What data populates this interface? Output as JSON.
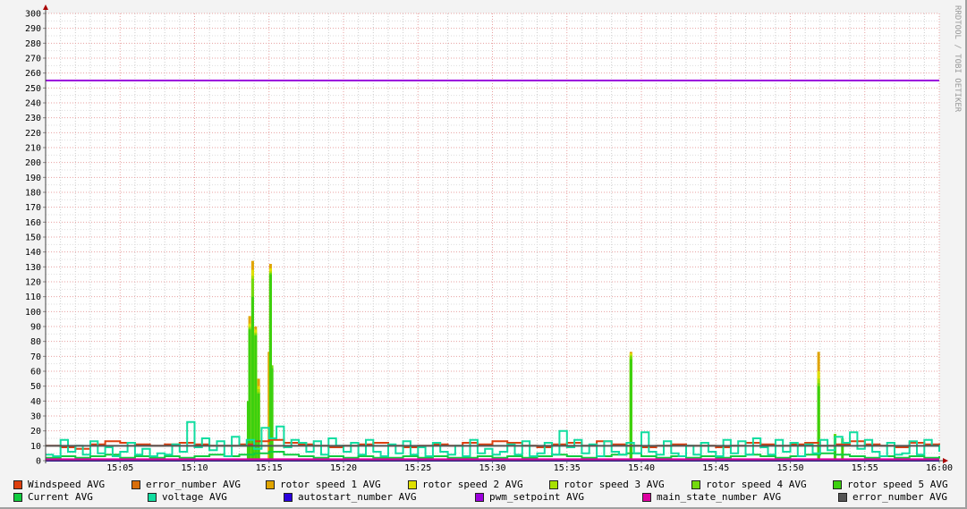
{
  "chart_data": {
    "type": "line",
    "title": "",
    "watermark": "RRDTOOL / TOBI OETIKER",
    "xlabel": "",
    "ylabel": "",
    "ylim": [
      0,
      300
    ],
    "xlim_minutes": [
      0,
      60
    ],
    "y_ticks": [
      "0",
      "10",
      "20",
      "30",
      "40",
      "50",
      "60",
      "70",
      "80",
      "90",
      "100",
      "110",
      "120",
      "130",
      "140",
      "150",
      "160",
      "170",
      "180",
      "190",
      "200",
      "210",
      "220",
      "230",
      "240",
      "250",
      "260",
      "270",
      "280",
      "290",
      "300"
    ],
    "x_ticks": [
      {
        "t": 5,
        "label": "15:05"
      },
      {
        "t": 10,
        "label": "15:10"
      },
      {
        "t": 15,
        "label": "15:15"
      },
      {
        "t": 20,
        "label": "15:20"
      },
      {
        "t": 25,
        "label": "15:25"
      },
      {
        "t": 30,
        "label": "15:30"
      },
      {
        "t": 35,
        "label": "15:35"
      },
      {
        "t": 40,
        "label": "15:40"
      },
      {
        "t": 45,
        "label": "15:45"
      },
      {
        "t": 50,
        "label": "15:50"
      },
      {
        "t": 55,
        "label": "15:55"
      },
      {
        "t": 60,
        "label": "16:00"
      }
    ],
    "series": [
      {
        "name": "Windspeed AVG",
        "color": "#dd3f0e",
        "kind": "line",
        "step": 1,
        "values": [
          10,
          9,
          8,
          11,
          13,
          12,
          11,
          10,
          11,
          12,
          11,
          10,
          10,
          11,
          13,
          14,
          12,
          11,
          10,
          9,
          10,
          11,
          12,
          10,
          9,
          10,
          11,
          10,
          12,
          11,
          13,
          12,
          10,
          9,
          11,
          12,
          10,
          13,
          11,
          10,
          9,
          10,
          11,
          10,
          10,
          9,
          10,
          12,
          11,
          10,
          11,
          12,
          10,
          11,
          13,
          11,
          10,
          9,
          12,
          11,
          10
        ]
      },
      {
        "name": "error_number AVG",
        "color": "#d96e0b",
        "kind": "const",
        "value": 0
      },
      {
        "name": "rotor speed 1 AVG",
        "color": "#e0a400",
        "kind": "spikes",
        "points": [
          [
            13.7,
            97
          ],
          [
            13.9,
            134
          ],
          [
            14.1,
            90
          ],
          [
            14.3,
            55
          ],
          [
            15.0,
            73
          ],
          [
            15.1,
            132
          ],
          [
            39.3,
            73
          ],
          [
            51.9,
            73
          ]
        ]
      },
      {
        "name": "rotor speed 2 AVG",
        "color": "#dfe000",
        "kind": "spikes",
        "points": [
          [
            13.7,
            92
          ],
          [
            13.9,
            128
          ],
          [
            14.1,
            88
          ],
          [
            14.3,
            50
          ],
          [
            15.1,
            129
          ],
          [
            39.3,
            72
          ],
          [
            51.9,
            60
          ]
        ]
      },
      {
        "name": "rotor speed 3 AVG",
        "color": "#a8e000",
        "kind": "spikes",
        "points": [
          [
            13.7,
            90
          ],
          [
            13.9,
            124
          ],
          [
            14.1,
            86
          ],
          [
            14.3,
            48
          ],
          [
            15.1,
            127
          ],
          [
            39.3,
            71
          ],
          [
            51.9,
            55
          ]
        ]
      },
      {
        "name": "rotor speed 4 AVG",
        "color": "#74d90e",
        "kind": "spikes",
        "points": [
          [
            13.7,
            89
          ],
          [
            13.9,
            122
          ],
          [
            14.1,
            85
          ],
          [
            14.3,
            46
          ],
          [
            15.1,
            126
          ],
          [
            15.2,
            64
          ],
          [
            39.3,
            70
          ],
          [
            51.9,
            52
          ],
          [
            53.0,
            18
          ]
        ]
      },
      {
        "name": "rotor speed 5 AVG",
        "color": "#3cd00e",
        "kind": "spikes",
        "points": [
          [
            13.6,
            40
          ],
          [
            13.7,
            88
          ],
          [
            13.9,
            110
          ],
          [
            14.1,
            84
          ],
          [
            14.3,
            45
          ],
          [
            15.1,
            125
          ],
          [
            15.2,
            62
          ],
          [
            39.3,
            68
          ],
          [
            51.9,
            50
          ],
          [
            53.0,
            17
          ],
          [
            53.5,
            15
          ]
        ]
      },
      {
        "name": "Current AVG",
        "color": "#11cc3f",
        "kind": "line",
        "step": 1,
        "values": [
          2,
          3,
          2,
          3,
          4,
          2,
          3,
          2,
          3,
          2,
          3,
          4,
          3,
          4,
          5,
          6,
          4,
          3,
          2,
          3,
          2,
          3,
          2,
          2,
          3,
          2,
          3,
          2,
          2,
          3,
          2,
          3,
          2,
          3,
          4,
          3,
          2,
          3,
          4,
          5,
          3,
          2,
          3,
          2,
          3,
          2,
          3,
          4,
          3,
          2,
          3,
          4,
          5,
          4,
          3,
          2,
          3,
          2,
          3,
          2,
          3
        ]
      },
      {
        "name": "voltage AVG",
        "color": "#11dda0",
        "kind": "line",
        "step": 0.5,
        "values": [
          4,
          3,
          14,
          6,
          10,
          4,
          13,
          5,
          9,
          3,
          6,
          12,
          4,
          8,
          3,
          5,
          4,
          11,
          6,
          26,
          9,
          15,
          7,
          13,
          3,
          16,
          10,
          14,
          8,
          22,
          15,
          23,
          9,
          14,
          12,
          6,
          13,
          4,
          15,
          10,
          6,
          12,
          4,
          14,
          6,
          3,
          11,
          5,
          13,
          4,
          9,
          3,
          12,
          6,
          4,
          10,
          3,
          14,
          5,
          8,
          4,
          6,
          11,
          4,
          13,
          3,
          5,
          12,
          4,
          20,
          9,
          14,
          5,
          11,
          3,
          13,
          6,
          4,
          12,
          5,
          19,
          6,
          4,
          13,
          5,
          3,
          10,
          4,
          12,
          6,
          3,
          14,
          5,
          13,
          4,
          15,
          9,
          4,
          14,
          6,
          12,
          3,
          11,
          5,
          14,
          7,
          16,
          12,
          19,
          8,
          14,
          6,
          3,
          12,
          4,
          5,
          13,
          4,
          14,
          10,
          6
        ]
      },
      {
        "name": "autostart_number AVG",
        "color": "#2a00dd",
        "kind": "const",
        "value": 0
      },
      {
        "name": "pwm_setpoint AVG",
        "color": "#9c00dd",
        "kind": "const",
        "value": 255
      },
      {
        "name": "main_state_number AVG",
        "color": "#dd00a0",
        "kind": "const",
        "value": 1
      },
      {
        "name": "error_number AVG",
        "color": "#555555",
        "kind": "const",
        "value": 10
      }
    ]
  }
}
